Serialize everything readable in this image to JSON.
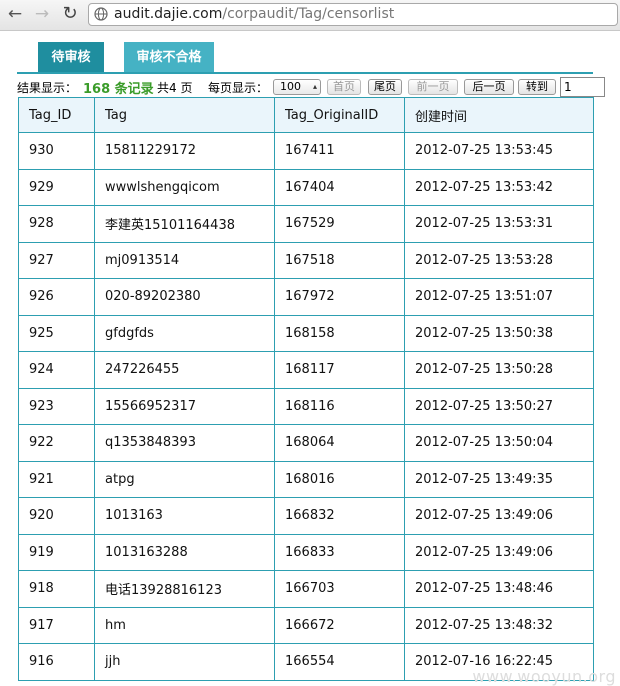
{
  "browser": {
    "url_host": "audit.dajie.com",
    "url_path": "/corpaudit/Tag/censorlist"
  },
  "tabs": [
    "待审核",
    "审核不合格"
  ],
  "toolbar": {
    "result_label": "结果显示：",
    "count": "168 条记录",
    "pages": "共4 页",
    "per_page_label": "每页显示：",
    "per_page_value": "100",
    "first": "首页",
    "last": "尾页",
    "prev": "前一页",
    "next": "后一页",
    "goto": "转到",
    "page_input": "1"
  },
  "table": {
    "columns": [
      "Tag_ID",
      "Tag",
      "Tag_OriginalID",
      "创建时间"
    ],
    "rows": [
      [
        "930",
        "15811229172",
        "167411",
        "2012-07-25 13:53:45"
      ],
      [
        "929",
        "wwwlshengqicom",
        "167404",
        "2012-07-25 13:53:42"
      ],
      [
        "928",
        "李建英15101164438",
        "167529",
        "2012-07-25 13:53:31"
      ],
      [
        "927",
        "mj0913514",
        "167518",
        "2012-07-25 13:53:28"
      ],
      [
        "926",
        "020-89202380",
        "167972",
        "2012-07-25 13:51:07"
      ],
      [
        "925",
        "gfdgfds",
        "168158",
        "2012-07-25 13:50:38"
      ],
      [
        "924",
        "247226455",
        "168117",
        "2012-07-25 13:50:28"
      ],
      [
        "923",
        "15566952317",
        "168116",
        "2012-07-25 13:50:27"
      ],
      [
        "922",
        "q1353848393",
        "168064",
        "2012-07-25 13:50:04"
      ],
      [
        "921",
        "atpg",
        "168016",
        "2012-07-25 13:49:35"
      ],
      [
        "920",
        "1013163",
        "166832",
        "2012-07-25 13:49:06"
      ],
      [
        "919",
        "1013163288",
        "166833",
        "2012-07-25 13:49:06"
      ],
      [
        "918",
        "电话13928816123",
        "166703",
        "2012-07-25 13:48:46"
      ],
      [
        "917",
        "hm",
        "166672",
        "2012-07-25 13:48:32"
      ],
      [
        "916",
        "jjh",
        "166554",
        "2012-07-16 16:22:45"
      ]
    ]
  },
  "watermark": "www.wooyun.org",
  "colors": {
    "tab_active": "#1f8e9f",
    "tab_inactive": "#45b2c4",
    "table_border": "#2d9fb1",
    "header_bg": "#eaf5fb",
    "count_green": "#3b9c2a"
  }
}
